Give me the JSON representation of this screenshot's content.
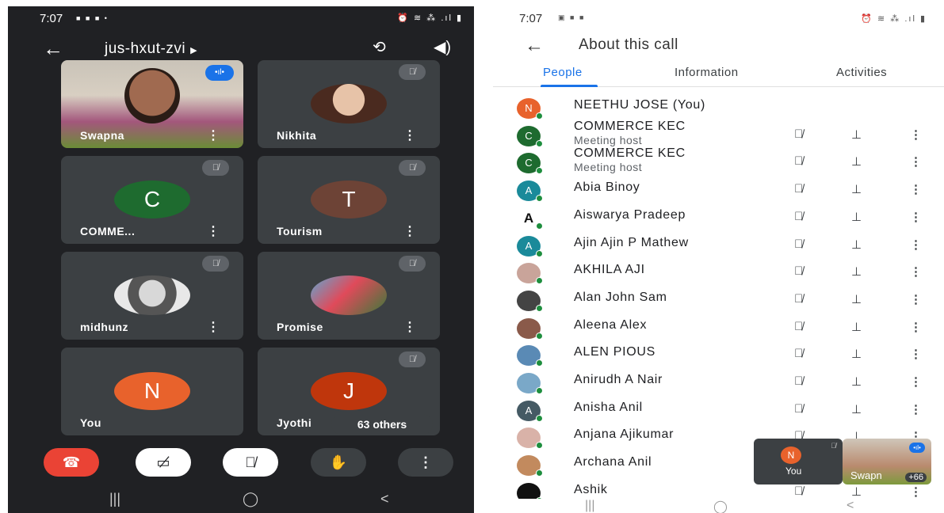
{
  "left": {
    "status": {
      "time": "7:07",
      "notif_icons": "■ ■ ■ •",
      "system_icons": "⏰ ≋ ⁂ .ıl ▮"
    },
    "meeting_code": "jus-hxut-zvi",
    "tiles": [
      {
        "name": "Swapna",
        "type": "video"
      },
      {
        "name": "Nikhita",
        "type": "photo"
      },
      {
        "name": "COMME...",
        "initial": "C",
        "color": "#1e6b2f"
      },
      {
        "name": "Tourism",
        "initial": "T",
        "color": "#6d4336"
      },
      {
        "name": "midhunz",
        "type": "photo"
      },
      {
        "name": "Promise",
        "type": "photo"
      },
      {
        "name": "You",
        "initial": "N",
        "color": "#e8622c"
      },
      {
        "name": "Jyothi",
        "initial": "J",
        "color": "#bf360c"
      }
    ],
    "others_label": "63 others",
    "nav": {
      "recents": "|||",
      "home": "◯",
      "back": "<"
    }
  },
  "right": {
    "status": {
      "time": "7:07",
      "notif_icons": "▣ ■ ■",
      "system_icons": "⏰ ≋ ⁂ .ıl ▮"
    },
    "title": "About this call",
    "tabs": [
      "People",
      "Information",
      "Activities"
    ],
    "people": [
      {
        "name": "NEETHU JOSE (You)",
        "initial": "N",
        "color": "#e8622c"
      },
      {
        "name": "COMMERCE KEC",
        "sub": "Meeting host",
        "initial": "C",
        "color": "#1e6b2f"
      },
      {
        "name": "COMMERCE KEC",
        "sub": "Meeting host",
        "initial": "C",
        "color": "#1e6b2f"
      },
      {
        "name": "Abia Binoy",
        "initial": "A",
        "color": "#1a8a9a"
      },
      {
        "name": "Aiswarya Pradeep",
        "initial": "A",
        "color": "letter"
      },
      {
        "name": "Ajin Ajin P Mathew",
        "initial": "A",
        "color": "#1a8a9a"
      },
      {
        "name": "AKHILA AJI",
        "initial": "",
        "color": "#c9a49a"
      },
      {
        "name": "Alan John Sam",
        "initial": "",
        "color": "#444444"
      },
      {
        "name": "Aleena Alex",
        "initial": "",
        "color": "#8a5a4a"
      },
      {
        "name": "ALEN PIOUS",
        "initial": "",
        "color": "#5a8ab5"
      },
      {
        "name": "Anirudh A Nair",
        "initial": "",
        "color": "#7aa8c8"
      },
      {
        "name": "Anisha Anil",
        "initial": "A",
        "color": "#455a64"
      },
      {
        "name": "Anjana Ajikumar",
        "initial": "",
        "color": "#d9b2a8"
      },
      {
        "name": "Archana Anil",
        "initial": "",
        "color": "#c28a5e"
      },
      {
        "name": "Ashik",
        "initial": "",
        "color": "#111111"
      }
    ],
    "pip": {
      "you_initial": "N",
      "you_label": "You",
      "other_label": "Swapn",
      "count": "+66"
    },
    "nav": {
      "recents": "|||",
      "home": "◯",
      "back": "<"
    }
  }
}
